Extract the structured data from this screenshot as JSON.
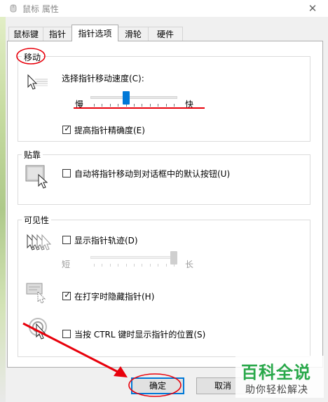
{
  "window": {
    "title": "鼠标 属性",
    "close_glyph": "✕"
  },
  "tabs": [
    {
      "label": "鼠标键",
      "active": false
    },
    {
      "label": "指针",
      "active": false
    },
    {
      "label": "指针选项",
      "active": true
    },
    {
      "label": "滑轮",
      "active": false
    },
    {
      "label": "硬件",
      "active": false
    }
  ],
  "motion": {
    "title": "移动",
    "speed_label": "选择指针移动速度(C):",
    "slow_label": "慢",
    "fast_label": "快",
    "speed_level": 0.4,
    "precision_label": "提高指针精确度(E)",
    "precision_checked": true
  },
  "snap": {
    "title": "贴靠",
    "label": "自动将指针移动到对话框中的默认按钮(U)",
    "checked": false
  },
  "visibility": {
    "title": "可见性",
    "trails_label": "显示指针轨迹(D)",
    "trails_checked": false,
    "short_label": "短",
    "long_label": "长",
    "trail_level": 1.0,
    "hide_label": "在打字时隐藏指针(H)",
    "hide_checked": true,
    "ctrl_label": "当按 CTRL 键时显示指针的位置(S)",
    "ctrl_checked": false
  },
  "buttons": {
    "ok": "确定",
    "cancel": "取消"
  },
  "watermark": {
    "title": "百科全说",
    "subtitle": "助你轻松解决"
  },
  "check_glyph": "✓",
  "colors": {
    "annotation_red": "#e8000b",
    "accent": "#0078d7",
    "watermark_green": "#29a84a"
  },
  "icons": {
    "speed": "pointer-speed-icon",
    "snap": "snap-to-icon",
    "trails": "pointer-trails-icon",
    "hide": "hide-pointer-icon",
    "ctrl": "ctrl-locate-icon"
  }
}
